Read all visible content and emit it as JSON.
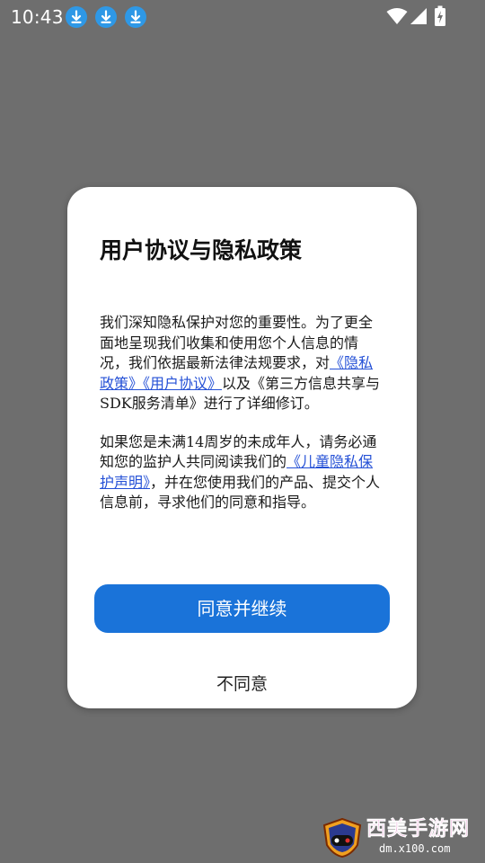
{
  "status_bar": {
    "time": "10:43",
    "notification_icons": [
      "download-icon",
      "download-icon",
      "download-icon"
    ],
    "system_icons": [
      "wifi-icon",
      "cellular-signal-icon",
      "battery-charging-icon"
    ],
    "icon_color": "#2e98e6"
  },
  "dialog": {
    "title": "用户协议与隐私政策",
    "paragraph1": {
      "text_before": "我们深知隐私保护对您的重要性。为了更全面地呈现我们收集和使用您个人信息的情况，我们依据最新法律法规要求，对",
      "link_privacy": "《隐私政策》",
      "link_user_agreement": "《用户协议》",
      "text_middle": "以及",
      "text_after": "《第三方信息共享与SDK服务清单》进行了详细修订。"
    },
    "paragraph2": {
      "text_before": "如果您是未满14周岁的未成年人，请务必通知您的监护人共同阅读我们的",
      "link_child_privacy": "《儿童隐私保护声明》",
      "text_after": "，并在您使用我们的产品、提交个人信息前，寻求他们的同意和指导。"
    },
    "agree_button": "同意并继续",
    "disagree_button": "不同意",
    "colors": {
      "primary": "#1a73d9",
      "link": "#2450d6",
      "overlay": "#6e6e6e"
    }
  },
  "watermark": {
    "title": "西美手游网",
    "url": "dm.x100.com"
  }
}
